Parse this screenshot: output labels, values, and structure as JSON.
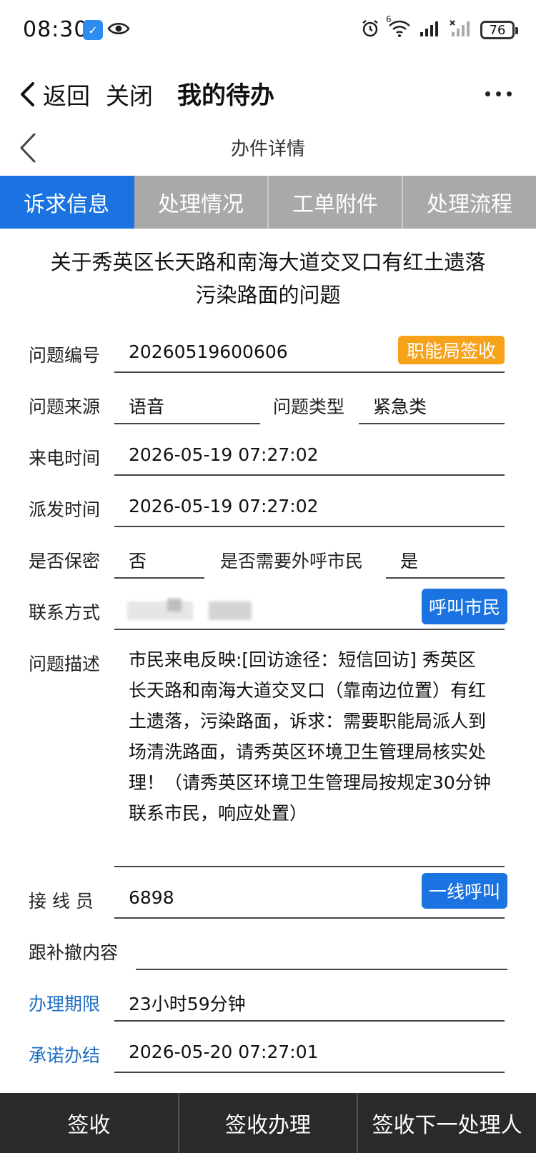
{
  "status_bar": {
    "time": "08:30",
    "battery": "76",
    "network_label": "6"
  },
  "header": {
    "back_label": "返回",
    "close_label": "关闭",
    "title": "我的待办"
  },
  "subheader": {
    "title": "办件详情"
  },
  "tabs": [
    {
      "label": "诉求信息",
      "active": true
    },
    {
      "label": "处理情况",
      "active": false
    },
    {
      "label": "工单附件",
      "active": false
    },
    {
      "label": "处理流程",
      "active": false
    }
  ],
  "issue": {
    "title_line1": "关于秀英区长天路和南海大道交叉口有红土遗落",
    "title_line2": "污染路面的问题"
  },
  "form": {
    "issue_no_label": "问题编号",
    "issue_no": "20260519600606",
    "sign_button": "职能局签收",
    "source_label": "问题来源",
    "source": "语音",
    "type_label": "问题类型",
    "type": "紧急类",
    "call_time_label": "来电时间",
    "call_time": "2026-05-19 07:27:02",
    "dispatch_time_label": "派发时间",
    "dispatch_time": "2026-05-19 07:27:02",
    "secret_label": "是否保密",
    "secret": "否",
    "callout_label": "是否需要外呼市民",
    "callout": "是",
    "contact_label": "联系方式",
    "call_citizen_button": "呼叫市民",
    "desc_label": "问题描述",
    "desc": "市民来电反映:[回访途径：短信回访] 秀英区长天路和南海大道交叉口（靠南边位置）有红土遗落，污染路面，诉求：需要职能局派人到场清洗路面，请秀英区环境卫生管理局核实处理！（请秀英区环境卫生管理局按规定30分钟联系市民，响应处置）",
    "operator_label": "接 线 员",
    "operator": "6898",
    "frontline_call_button": "一线呼叫",
    "followup_label": "跟补撤内容",
    "followup": "",
    "deadline_label": "办理期限",
    "deadline": "23小时59分钟",
    "promise_label": "承诺办结",
    "promise": "2026-05-20 07:27:01"
  },
  "bottom_bar": {
    "sign_label": "签收",
    "sign_handle_label": "签收办理",
    "sign_next_label": "签收下一处理人"
  },
  "colors": {
    "accent": "#1a73e0",
    "orange": "#f7a21b",
    "tab_inactive": "#a9a9a9",
    "label_blue": "#1f6fc5"
  }
}
